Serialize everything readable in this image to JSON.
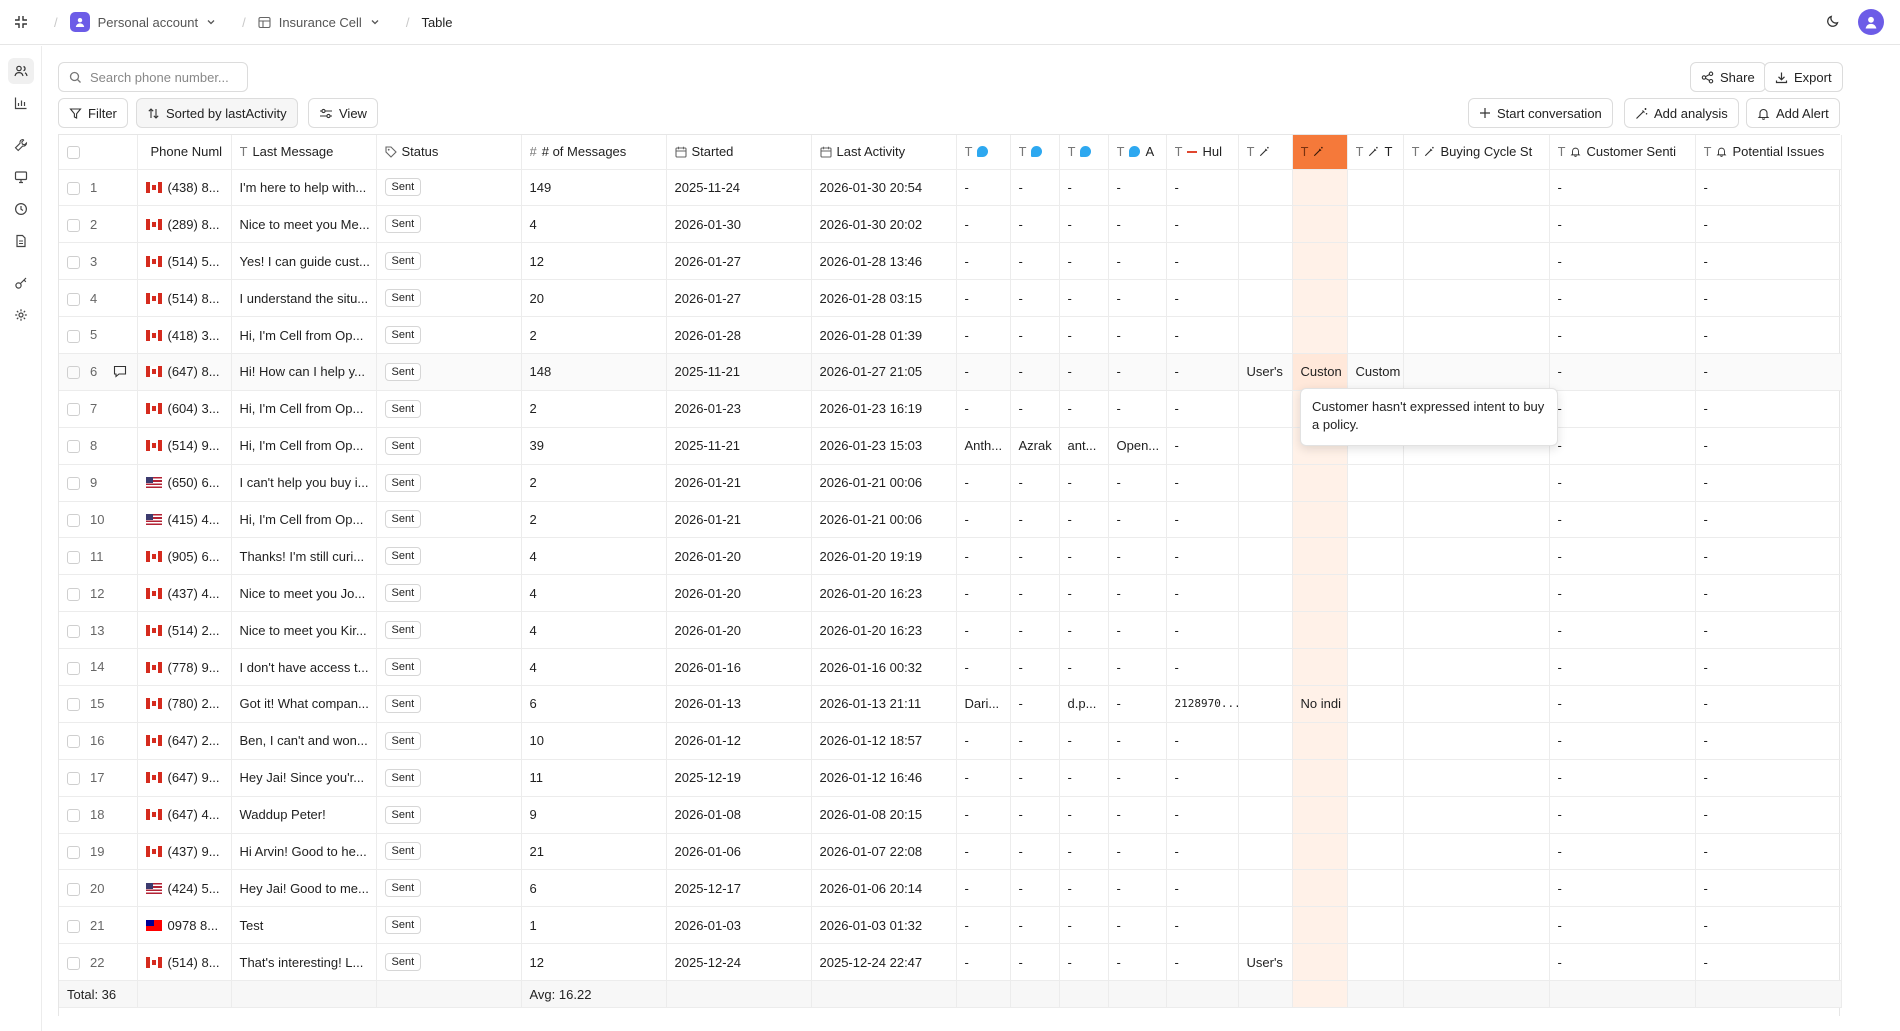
{
  "topbar": {
    "workspace": "Personal account",
    "project": "Insurance Cell",
    "page": "Table"
  },
  "toolbar": {
    "search_placeholder": "Search phone number...",
    "share": "Share",
    "export": "Export",
    "filter": "Filter",
    "sorted": "Sorted by lastActivity",
    "view": "View",
    "start_conversation": "Start conversation",
    "add_analysis": "Add analysis",
    "add_alert": "Add Alert"
  },
  "columns": {
    "phone": "Phone Numl",
    "last_message": "Last Message",
    "status": "Status",
    "messages": "# of Messages",
    "started": "Started",
    "last_activity": "Last Activity",
    "c7": "",
    "c8": "",
    "c9": "",
    "c10": "A",
    "c11": "Hul",
    "c12": "",
    "c13": "",
    "c14": "T",
    "buying_cycle": "Buying Cycle St",
    "customer_senti": "Customer Senti",
    "potential_issues": "Potential Issues"
  },
  "rows": [
    {
      "n": "1",
      "flag": "ca",
      "phone": "(438) 8...",
      "msg": "I'm here to help with...",
      "status": "Sent",
      "count": "149",
      "started": "2025-11-24",
      "last": "2026-01-30 20:54",
      "c7": "-",
      "c8": "-",
      "c9": "-",
      "c10": "-",
      "c11": "-",
      "c12": "",
      "c13": "",
      "c14": "",
      "c15": "",
      "c16": "-",
      "c17": "-"
    },
    {
      "n": "2",
      "flag": "ca",
      "phone": "(289) 8...",
      "msg": "Nice to meet you Me...",
      "status": "Sent",
      "count": "4",
      "started": "2026-01-30",
      "last": "2026-01-30 20:02",
      "c7": "-",
      "c8": "-",
      "c9": "-",
      "c10": "-",
      "c11": "-",
      "c12": "",
      "c13": "",
      "c14": "",
      "c15": "",
      "c16": "-",
      "c17": "-"
    },
    {
      "n": "3",
      "flag": "ca",
      "phone": "(514) 5...",
      "msg": "Yes! I can guide cust...",
      "status": "Sent",
      "count": "12",
      "started": "2026-01-27",
      "last": "2026-01-28 13:46",
      "c7": "-",
      "c8": "-",
      "c9": "-",
      "c10": "-",
      "c11": "-",
      "c12": "",
      "c13": "",
      "c14": "",
      "c15": "",
      "c16": "-",
      "c17": "-"
    },
    {
      "n": "4",
      "flag": "ca",
      "phone": "(514) 8...",
      "msg": "I understand the situ...",
      "status": "Sent",
      "count": "20",
      "started": "2026-01-27",
      "last": "2026-01-28 03:15",
      "c7": "-",
      "c8": "-",
      "c9": "-",
      "c10": "-",
      "c11": "-",
      "c12": "",
      "c13": "",
      "c14": "",
      "c15": "",
      "c16": "-",
      "c17": "-"
    },
    {
      "n": "5",
      "flag": "ca",
      "phone": "(418) 3...",
      "msg": "Hi, I'm Cell from Op...",
      "status": "Sent",
      "count": "2",
      "started": "2026-01-28",
      "last": "2026-01-28 01:39",
      "c7": "-",
      "c8": "-",
      "c9": "-",
      "c10": "-",
      "c11": "-",
      "c12": "",
      "c13": "",
      "c14": "",
      "c15": "",
      "c16": "-",
      "c17": "-"
    },
    {
      "n": "6",
      "flag": "ca",
      "phone": "(647) 8...",
      "msg": "Hi! How can I help y...",
      "status": "Sent",
      "count": "148",
      "started": "2025-11-21",
      "last": "2026-01-27 21:05",
      "c7": "-",
      "c8": "-",
      "c9": "-",
      "c10": "-",
      "c11": "-",
      "c12": "User's",
      "c13": "Custon",
      "c14": "Custom",
      "c15": "",
      "c16": "-",
      "c17": "-",
      "hover": true
    },
    {
      "n": "7",
      "flag": "ca",
      "phone": "(604) 3...",
      "msg": "Hi, I'm Cell from Op...",
      "status": "Sent",
      "count": "2",
      "started": "2026-01-23",
      "last": "2026-01-23 16:19",
      "c7": "-",
      "c8": "-",
      "c9": "-",
      "c10": "-",
      "c11": "-",
      "c12": "",
      "c13": "",
      "c14": "",
      "c15": "",
      "c16": "-",
      "c17": "-"
    },
    {
      "n": "8",
      "flag": "ca",
      "phone": "(514) 9...",
      "msg": "Hi, I'm Cell from Op...",
      "status": "Sent",
      "count": "39",
      "started": "2025-11-21",
      "last": "2026-01-23 15:03",
      "c7": "Anth...",
      "c8": "Azrak",
      "c9": "ant...",
      "c10": "Open...",
      "c11": "-",
      "c12": "",
      "c13": "",
      "c14": "",
      "c15": "",
      "c16": "-",
      "c17": "-"
    },
    {
      "n": "9",
      "flag": "us",
      "phone": "(650) 6...",
      "msg": "I can't help you buy i...",
      "status": "Sent",
      "count": "2",
      "started": "2026-01-21",
      "last": "2026-01-21 00:06",
      "c7": "-",
      "c8": "-",
      "c9": "-",
      "c10": "-",
      "c11": "-",
      "c12": "",
      "c13": "",
      "c14": "",
      "c15": "",
      "c16": "-",
      "c17": "-"
    },
    {
      "n": "10",
      "flag": "us",
      "phone": "(415) 4...",
      "msg": "Hi, I'm Cell from Op...",
      "status": "Sent",
      "count": "2",
      "started": "2026-01-21",
      "last": "2026-01-21 00:06",
      "c7": "-",
      "c8": "-",
      "c9": "-",
      "c10": "-",
      "c11": "-",
      "c12": "",
      "c13": "",
      "c14": "",
      "c15": "",
      "c16": "-",
      "c17": "-"
    },
    {
      "n": "11",
      "flag": "ca",
      "phone": "(905) 6...",
      "msg": "Thanks! I'm still curi...",
      "status": "Sent",
      "count": "4",
      "started": "2026-01-20",
      "last": "2026-01-20 19:19",
      "c7": "-",
      "c8": "-",
      "c9": "-",
      "c10": "-",
      "c11": "-",
      "c12": "",
      "c13": "",
      "c14": "",
      "c15": "",
      "c16": "-",
      "c17": "-"
    },
    {
      "n": "12",
      "flag": "ca",
      "phone": "(437) 4...",
      "msg": "Nice to meet you Jo...",
      "status": "Sent",
      "count": "4",
      "started": "2026-01-20",
      "last": "2026-01-20 16:23",
      "c7": "-",
      "c8": "-",
      "c9": "-",
      "c10": "-",
      "c11": "-",
      "c12": "",
      "c13": "",
      "c14": "",
      "c15": "",
      "c16": "-",
      "c17": "-"
    },
    {
      "n": "13",
      "flag": "ca",
      "phone": "(514) 2...",
      "msg": "Nice to meet you Kir...",
      "status": "Sent",
      "count": "4",
      "started": "2026-01-20",
      "last": "2026-01-20 16:23",
      "c7": "-",
      "c8": "-",
      "c9": "-",
      "c10": "-",
      "c11": "-",
      "c12": "",
      "c13": "",
      "c14": "",
      "c15": "",
      "c16": "-",
      "c17": "-"
    },
    {
      "n": "14",
      "flag": "ca",
      "phone": "(778) 9...",
      "msg": "I don't have access t...",
      "status": "Sent",
      "count": "4",
      "started": "2026-01-16",
      "last": "2026-01-16 00:32",
      "c7": "-",
      "c8": "-",
      "c9": "-",
      "c10": "-",
      "c11": "-",
      "c12": "",
      "c13": "",
      "c14": "",
      "c15": "",
      "c16": "-",
      "c17": "-"
    },
    {
      "n": "15",
      "flag": "ca",
      "phone": "(780) 2...",
      "msg": "Got it! What compan...",
      "status": "Sent",
      "count": "6",
      "started": "2026-01-13",
      "last": "2026-01-13 21:11",
      "c7": "Dari...",
      "c8": "-",
      "c9": "d.p...",
      "c10": "-",
      "c11": "2128970...",
      "c12": "",
      "c13": "No indi",
      "c14": "",
      "c15": "",
      "c16": "-",
      "c17": "-"
    },
    {
      "n": "16",
      "flag": "ca",
      "phone": "(647) 2...",
      "msg": "Ben, I can't and won...",
      "status": "Sent",
      "count": "10",
      "started": "2026-01-12",
      "last": "2026-01-12 18:57",
      "c7": "-",
      "c8": "-",
      "c9": "-",
      "c10": "-",
      "c11": "-",
      "c12": "",
      "c13": "",
      "c14": "",
      "c15": "",
      "c16": "-",
      "c17": "-"
    },
    {
      "n": "17",
      "flag": "ca",
      "phone": "(647) 9...",
      "msg": "Hey Jai! Since you'r...",
      "status": "Sent",
      "count": "11",
      "started": "2025-12-19",
      "last": "2026-01-12 16:46",
      "c7": "-",
      "c8": "-",
      "c9": "-",
      "c10": "-",
      "c11": "-",
      "c12": "",
      "c13": "",
      "c14": "",
      "c15": "",
      "c16": "-",
      "c17": "-"
    },
    {
      "n": "18",
      "flag": "ca",
      "phone": "(647) 4...",
      "msg": "Waddup Peter!",
      "status": "Sent",
      "count": "9",
      "started": "2026-01-08",
      "last": "2026-01-08 20:15",
      "c7": "-",
      "c8": "-",
      "c9": "-",
      "c10": "-",
      "c11": "-",
      "c12": "",
      "c13": "",
      "c14": "",
      "c15": "",
      "c16": "-",
      "c17": "-"
    },
    {
      "n": "19",
      "flag": "ca",
      "phone": "(437) 9...",
      "msg": "Hi Arvin! Good to he...",
      "status": "Sent",
      "count": "21",
      "started": "2026-01-06",
      "last": "2026-01-07 22:08",
      "c7": "-",
      "c8": "-",
      "c9": "-",
      "c10": "-",
      "c11": "-",
      "c12": "",
      "c13": "",
      "c14": "",
      "c15": "",
      "c16": "-",
      "c17": "-"
    },
    {
      "n": "20",
      "flag": "us",
      "phone": "(424) 5...",
      "msg": "Hey Jai! Good to me...",
      "status": "Sent",
      "count": "6",
      "started": "2025-12-17",
      "last": "2026-01-06 20:14",
      "c7": "-",
      "c8": "-",
      "c9": "-",
      "c10": "-",
      "c11": "-",
      "c12": "",
      "c13": "",
      "c14": "",
      "c15": "",
      "c16": "-",
      "c17": "-"
    },
    {
      "n": "21",
      "flag": "tw",
      "phone": "0978 8...",
      "msg": "Test",
      "status": "Sent",
      "count": "1",
      "started": "2026-01-03",
      "last": "2026-01-03 01:32",
      "c7": "-",
      "c8": "-",
      "c9": "-",
      "c10": "-",
      "c11": "-",
      "c12": "",
      "c13": "",
      "c14": "",
      "c15": "",
      "c16": "-",
      "c17": "-"
    },
    {
      "n": "22",
      "flag": "ca",
      "phone": "(514) 8...",
      "msg": "That's interesting! L...",
      "status": "Sent",
      "count": "12",
      "started": "2025-12-24",
      "last": "2025-12-24 22:47",
      "c7": "-",
      "c8": "-",
      "c9": "-",
      "c10": "-",
      "c11": "-",
      "c12": "User's",
      "c13": "",
      "c14": "",
      "c15": "",
      "c16": "-",
      "c17": "-"
    }
  ],
  "footer": {
    "total": "Total: 36",
    "avg": "Avg: 16.22"
  },
  "tooltip": {
    "text": "Customer hasn't expressed intent to buy a policy."
  },
  "colors": {
    "accent": "#6c5ce7",
    "highlight_column": "#f5793a",
    "highlight_bg": "#fff1e8"
  }
}
